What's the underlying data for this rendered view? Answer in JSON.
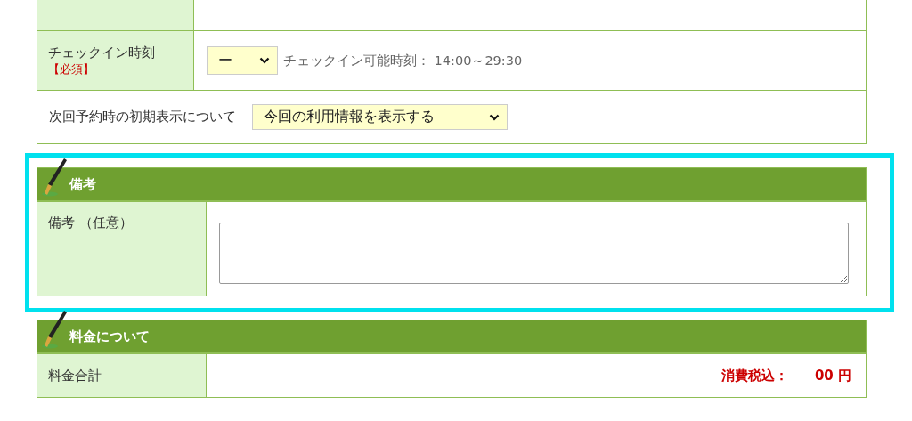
{
  "top_table": {
    "rows": [
      {
        "kind": "blank"
      },
      {
        "kind": "select",
        "label": "チェックイン時刻",
        "required": "【必須】",
        "select": {
          "value": "ー"
        },
        "note": "チェックイン可能時刻： 14:00～29:30"
      },
      {
        "kind": "wide_select",
        "label": "次回予約時の初期表示について",
        "select": {
          "value": "今回の利用情報を表示する"
        }
      }
    ]
  },
  "sections": [
    {
      "title": "備考",
      "highlighted": true,
      "rows": [
        {
          "kind": "textarea",
          "label": "備考 （任意）"
        }
      ]
    },
    {
      "title": "料金について",
      "rows": [
        {
          "kind": "price",
          "label": "料金合計",
          "price_label": "消費税込：",
          "price_value": "00 円"
        }
      ]
    }
  ]
}
